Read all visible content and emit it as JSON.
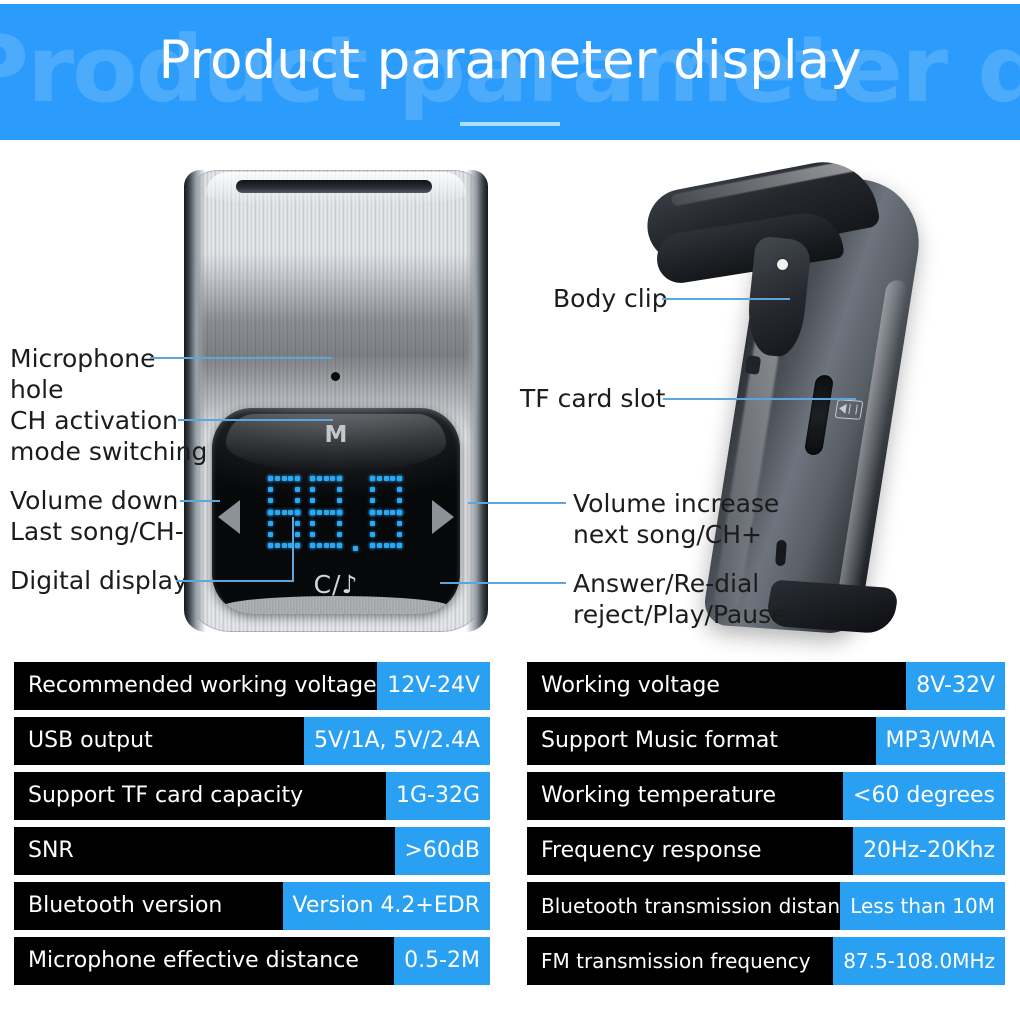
{
  "header": {
    "title": "Product parameter display",
    "watermark": "Product parameter display",
    "banner_color": "#2b9bfc",
    "underline_color": "#a9e0fb"
  },
  "product": {
    "front_device": {
      "mode_label": "M",
      "display_value": "88.8",
      "call_music_icon": "C/♪",
      "left_arrow_icon": "triangle-left",
      "right_arrow_icon": "triangle-right"
    },
    "side_device": {
      "card_slot_icon": "tf-card-icon"
    },
    "callouts": [
      {
        "id": "microphone-hole",
        "lines": [
          "Microphone",
          "hole"
        ]
      },
      {
        "id": "ch-activation",
        "lines": [
          "CH activation",
          "mode switching"
        ]
      },
      {
        "id": "volume-down",
        "lines": [
          "Volume down",
          "Last song/CH-"
        ]
      },
      {
        "id": "digital-display",
        "lines": [
          "Digital display"
        ]
      },
      {
        "id": "body-clip",
        "lines": [
          "Body clip"
        ]
      },
      {
        "id": "tf-card-slot",
        "lines": [
          "TF card slot"
        ]
      },
      {
        "id": "volume-increase",
        "lines": [
          "Volume increase",
          "next song/CH+"
        ]
      },
      {
        "id": "answer-redial",
        "lines": [
          "Answer/Re-dial",
          "reject/Play/Pause"
        ]
      }
    ],
    "leader_line_color": "#5aa6dd"
  },
  "specs": {
    "label_bg": "#000000",
    "value_bg": "#29a0f2",
    "left": [
      {
        "label": "Recommended working voltage",
        "value": "12V-24V"
      },
      {
        "label": "USB output",
        "value": "5V/1A, 5V/2.4A"
      },
      {
        "label": "Support TF card capacity",
        "value": "1G-32G"
      },
      {
        "label": "SNR",
        "value": ">60dB"
      },
      {
        "label": "Bluetooth version",
        "value": "Version 4.2+EDR"
      },
      {
        "label": "Microphone effective distance",
        "value": "0.5-2M"
      }
    ],
    "right": [
      {
        "label": "Working voltage",
        "value": "8V-32V"
      },
      {
        "label": "Support Music format",
        "value": "MP3/WMA"
      },
      {
        "label": "Working temperature",
        "value": "<60 degrees"
      },
      {
        "label": "Frequency response",
        "value": "20Hz-20Khz"
      },
      {
        "label": "Bluetooth transmission distance",
        "value": "Less than 10M"
      },
      {
        "label": "FM transmission frequency",
        "value": "87.5-108.0MHz"
      }
    ]
  }
}
